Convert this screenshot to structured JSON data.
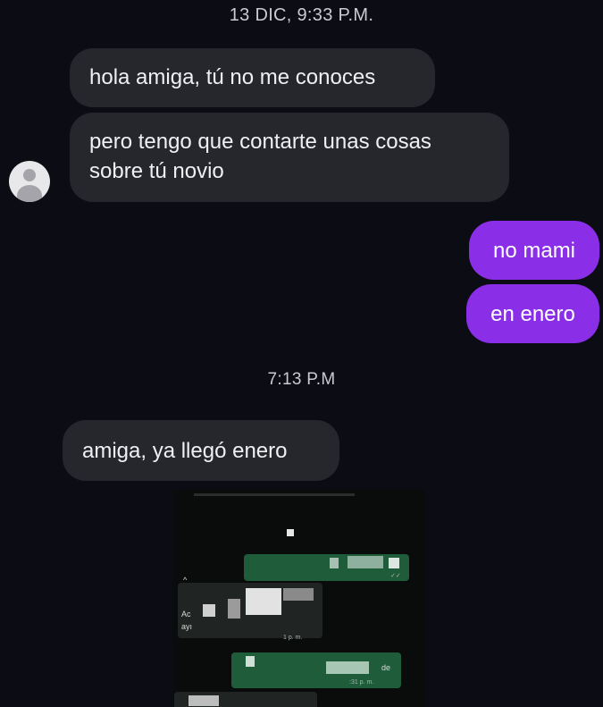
{
  "timestamps": [
    "13 DIC,  9:33 P.M.",
    "7:13 P.M"
  ],
  "messages": {
    "in_1": "hola amiga, tú no me conoces",
    "in_2_line1": "pero tengo que contarte unas cosas",
    "in_2_line2": "sobre tú novio",
    "out_1": "no mami",
    "out_2": "en enero",
    "in_3": "amiga, ya llegó enero"
  },
  "screenshot_fragments": {
    "caret": "^",
    "text_a": "Ac",
    "text_b": "ayı",
    "meta_1": "1 p. m.",
    "word_de": "de",
    "meta_2": ":31 p. m.",
    "check": "✓✓"
  },
  "colors": {
    "background": "#0c0d14",
    "incoming_bubble": "#25272d",
    "outgoing_bubble": "#8a2ee8",
    "whatsapp_green": "#1f5d3a"
  }
}
